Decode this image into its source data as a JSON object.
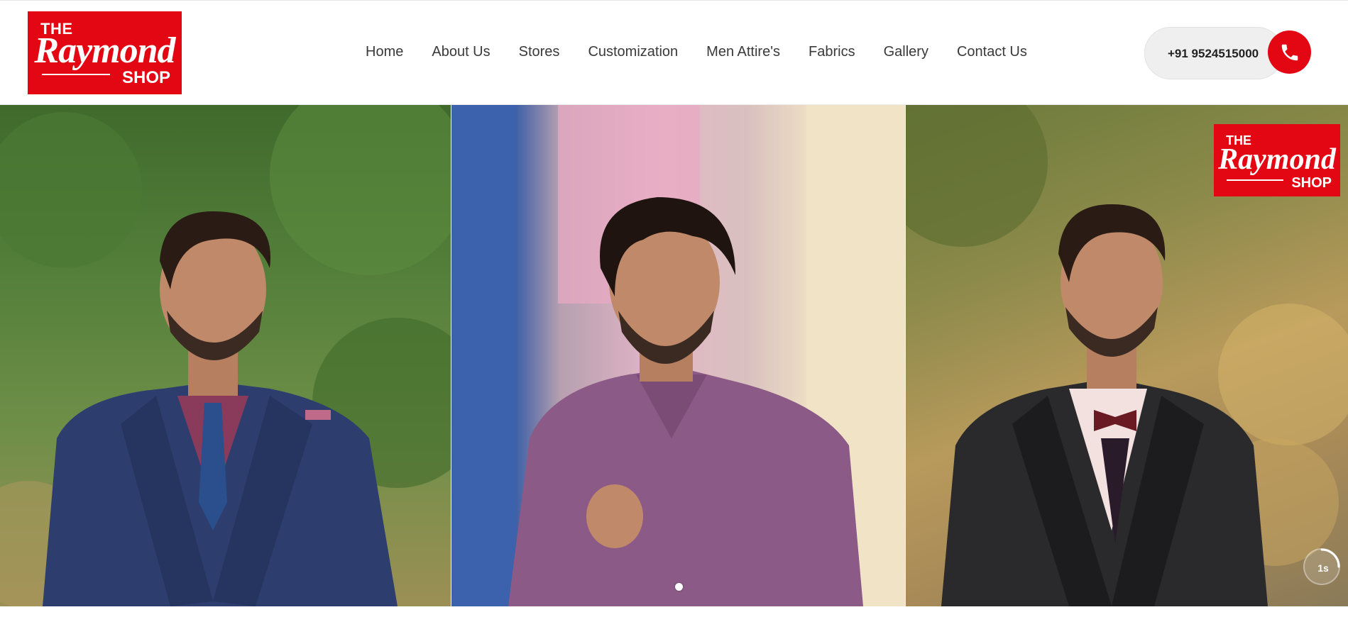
{
  "logo": {
    "the": "THE",
    "brand": "Raymond",
    "shop": "SHOP"
  },
  "nav": {
    "items": [
      {
        "label": "Home"
      },
      {
        "label": "About Us"
      },
      {
        "label": "Stores"
      },
      {
        "label": "Customization"
      },
      {
        "label": "Men Attire's"
      },
      {
        "label": "Fabrics"
      },
      {
        "label": "Gallery"
      },
      {
        "label": "Contact Us"
      }
    ]
  },
  "contact": {
    "phone": "+91 9524515000",
    "icon": "phone-icon"
  },
  "slider": {
    "corner_logo": {
      "the": "THE",
      "brand": "Raymond",
      "shop": "SHOP"
    },
    "timer_label": "1s",
    "timer_progress": 0.25,
    "active_slide": 1,
    "slide_count": 1
  },
  "colors": {
    "brand_red": "#e30613",
    "nav_text": "#3a3a3a",
    "pill_bg": "#efefef"
  }
}
